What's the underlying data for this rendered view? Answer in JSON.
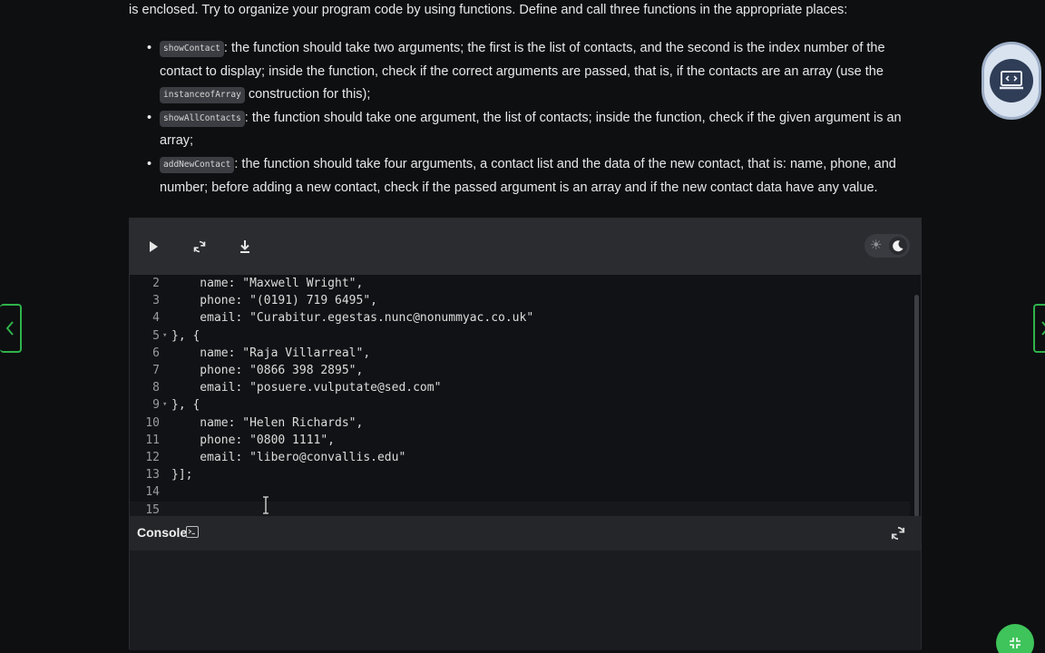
{
  "instructions": {
    "intro": "is enclosed. Try to organize your program code by using functions. Define and call three functions in the appropriate places:",
    "items": [
      {
        "code": "showContact",
        "text": ": the function should take two arguments; the first is the list of contacts, and the second is the index number of the contact to display; inside the function, check if the correct arguments are passed, that is, if the contacts are an array (use the ",
        "code2": "instanceofArray",
        "text2": " construction for this);"
      },
      {
        "code": "showAllContacts",
        "text": ": the function should take one argument, the list of contacts; inside the function, check if the given argument is an array;"
      },
      {
        "code": "addNewContact",
        "text": ": the function should take four arguments, a contact list and the data of the new contact, that is: name, phone, and number; before adding a new contact, check if the passed argument is an array and if the new contact data have any value."
      }
    ]
  },
  "toolbar": {
    "run_icon": "play-icon",
    "reset_icon": "refresh-icon",
    "download_icon": "download-icon",
    "theme_icons": [
      "sun-icon",
      "moon-icon"
    ]
  },
  "code_lines": [
    {
      "n": "2",
      "text": "    name: \"Maxwell Wright\","
    },
    {
      "n": "3",
      "text": "    phone: \"(0191) 719 6495\","
    },
    {
      "n": "4",
      "text": "    email: \"Curabitur.egestas.nunc@nonummyac.co.uk\""
    },
    {
      "n": "5",
      "text": "}, {",
      "fold": true
    },
    {
      "n": "6",
      "text": "    name: \"Raja Villarreal\","
    },
    {
      "n": "7",
      "text": "    phone: \"0866 398 2895\","
    },
    {
      "n": "8",
      "text": "    email: \"posuere.vulputate@sed.com\""
    },
    {
      "n": "9",
      "text": "}, {",
      "fold": true
    },
    {
      "n": "10",
      "text": "    name: \"Helen Richards\","
    },
    {
      "n": "11",
      "text": "    phone: \"0800 1111\","
    },
    {
      "n": "12",
      "text": "    email: \"libero@convallis.edu\""
    },
    {
      "n": "13",
      "text": "}];"
    },
    {
      "n": "14",
      "text": ""
    },
    {
      "n": "15",
      "text": ""
    }
  ],
  "console": {
    "label": "Console",
    "icon": "terminal-icon",
    "refresh_icon": "refresh-icon"
  },
  "nav": {
    "prev_icon": "chevron-left-icon",
    "next_icon": "chevron-right-icon"
  },
  "colors": {
    "accent": "#2fb34a",
    "background": "#0e0f11",
    "toolbar": "#2b2c30",
    "editor": "#111215"
  }
}
